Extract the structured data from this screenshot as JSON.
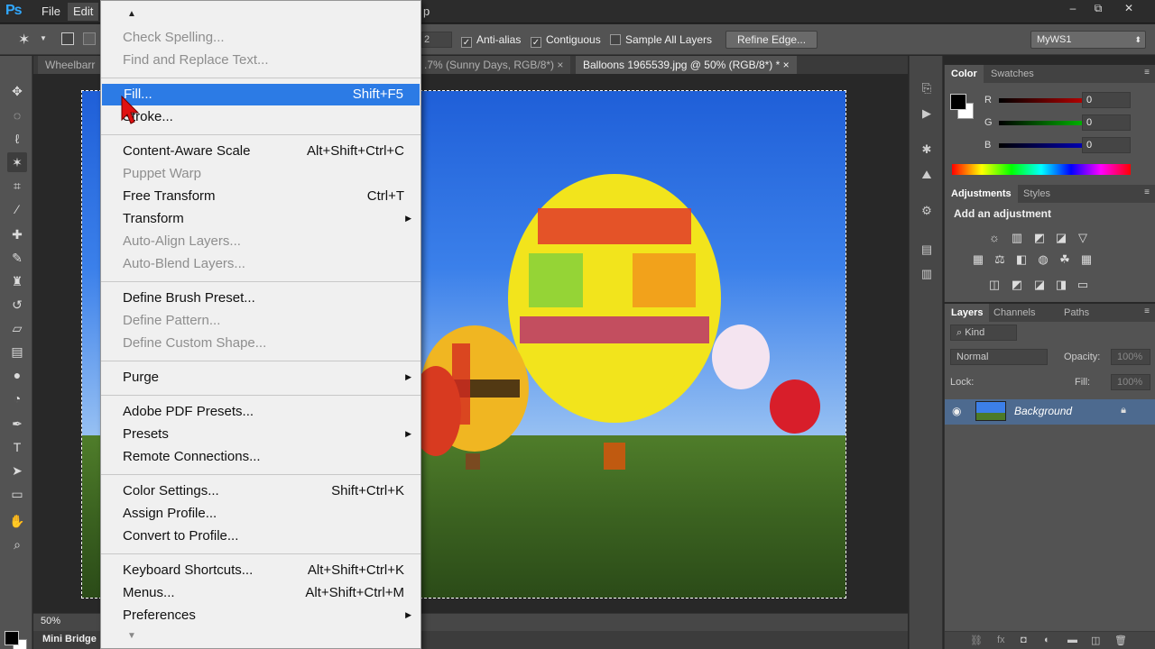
{
  "menubar": {
    "logo": "Ps",
    "items": [
      {
        "label": "File"
      },
      {
        "label": "Edit",
        "active": true
      },
      {
        "label": "p"
      }
    ],
    "window_controls": [
      "–",
      "⧉",
      "✕"
    ]
  },
  "options_bar": {
    "tool_icon": "magic-wand-icon",
    "size_value": "2",
    "anti_alias": {
      "label": "Anti-alias",
      "checked": true
    },
    "contiguous": {
      "label": "Contiguous",
      "checked": true
    },
    "sample_all_layers": {
      "label": "Sample All Layers",
      "checked": false
    },
    "refine_edge_label": "Refine Edge...",
    "workspace": "MyWS1"
  },
  "doc_tabs": [
    {
      "label": "Wheelbarr",
      "active": false
    },
    {
      "label": ".7% (Sunny Days, RGB/8*) ×",
      "active": false
    },
    {
      "label": "Balloons 1965539.jpg @ 50% (RGB/8*) * ×",
      "active": true
    }
  ],
  "status": {
    "zoom": "50%"
  },
  "mini_bridge": "Mini Bridge",
  "color_panel": {
    "tabs": [
      "Color",
      "Swatches"
    ],
    "channels": [
      {
        "label": "R",
        "value": "0",
        "color": "#e03030"
      },
      {
        "label": "G",
        "value": "0",
        "color": "#30c030"
      },
      {
        "label": "B",
        "value": "0",
        "color": "#3040e0"
      }
    ]
  },
  "adjustments_panel": {
    "tabs": [
      "Adjustments",
      "Styles"
    ],
    "title": "Add an adjustment"
  },
  "layers_panel": {
    "tabs": [
      "Layers",
      "Channels",
      "Paths"
    ],
    "kind": "Kind",
    "blend_mode": "Normal",
    "opacity_label": "Opacity:",
    "opacity_value": "100%",
    "lock_label": "Lock:",
    "fill_label": "Fill:",
    "fill_value": "100%",
    "layers": [
      {
        "name": "Background",
        "visible": true,
        "locked": true
      }
    ]
  },
  "edit_menu": {
    "items": [
      {
        "type": "item",
        "label": "Check Spelling...",
        "disabled": true
      },
      {
        "type": "item",
        "label": "Find and Replace Text...",
        "disabled": true
      },
      {
        "type": "sep"
      },
      {
        "type": "item",
        "label": "Fill...",
        "shortcut": "Shift+F5",
        "highlight": true
      },
      {
        "type": "item",
        "label": "Stroke..."
      },
      {
        "type": "sep"
      },
      {
        "type": "item",
        "label": "Content-Aware Scale",
        "shortcut": "Alt+Shift+Ctrl+C"
      },
      {
        "type": "item",
        "label": "Puppet Warp",
        "disabled": true
      },
      {
        "type": "item",
        "label": "Free Transform",
        "shortcut": "Ctrl+T"
      },
      {
        "type": "item",
        "label": "Transform",
        "submenu": true
      },
      {
        "type": "item",
        "label": "Auto-Align Layers...",
        "disabled": true
      },
      {
        "type": "item",
        "label": "Auto-Blend Layers...",
        "disabled": true
      },
      {
        "type": "sep"
      },
      {
        "type": "item",
        "label": "Define Brush Preset..."
      },
      {
        "type": "item",
        "label": "Define Pattern...",
        "disabled": true
      },
      {
        "type": "item",
        "label": "Define Custom Shape...",
        "disabled": true
      },
      {
        "type": "sep"
      },
      {
        "type": "item",
        "label": "Purge",
        "submenu": true
      },
      {
        "type": "sep"
      },
      {
        "type": "item",
        "label": "Adobe PDF Presets..."
      },
      {
        "type": "item",
        "label": "Presets",
        "submenu": true
      },
      {
        "type": "item",
        "label": "Remote Connections..."
      },
      {
        "type": "sep"
      },
      {
        "type": "item",
        "label": "Color Settings...",
        "shortcut": "Shift+Ctrl+K"
      },
      {
        "type": "item",
        "label": "Assign Profile..."
      },
      {
        "type": "item",
        "label": "Convert to Profile..."
      },
      {
        "type": "sep"
      },
      {
        "type": "item",
        "label": "Keyboard Shortcuts...",
        "shortcut": "Alt+Shift+Ctrl+K"
      },
      {
        "type": "item",
        "label": "Menus...",
        "shortcut": "Alt+Shift+Ctrl+M"
      },
      {
        "type": "item",
        "label": "Preferences",
        "submenu": true
      }
    ]
  },
  "colors": {
    "accent": "#2c7be5",
    "menu_bg": "#f0f0f0",
    "panel_bg": "#535353",
    "layer_selected": "#4d6a8f"
  }
}
